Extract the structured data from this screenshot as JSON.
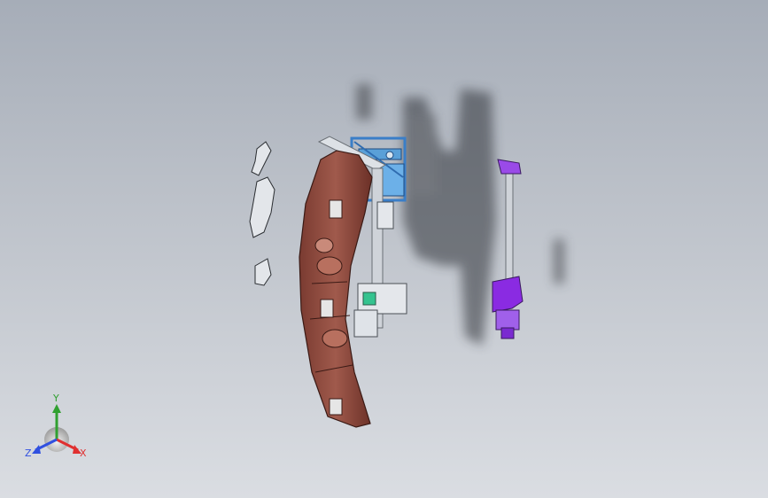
{
  "view": {
    "background_top": "#a6adb8",
    "background_bottom": "#dadde2"
  },
  "model": {
    "parts": [
      {
        "name": "fixture-base-frame",
        "color": "#5aa0d8"
      },
      {
        "name": "main-panel-part",
        "color": "#8a4a3e"
      },
      {
        "name": "clamp-assembly",
        "color": "#8a2be2"
      },
      {
        "name": "small-brackets",
        "color": "#d9dde2"
      }
    ]
  },
  "triad": {
    "x_label": "X",
    "y_label": "Y",
    "z_label": "Z",
    "x_color": "#e03030",
    "y_color": "#30a030",
    "z_color": "#3050e0"
  }
}
